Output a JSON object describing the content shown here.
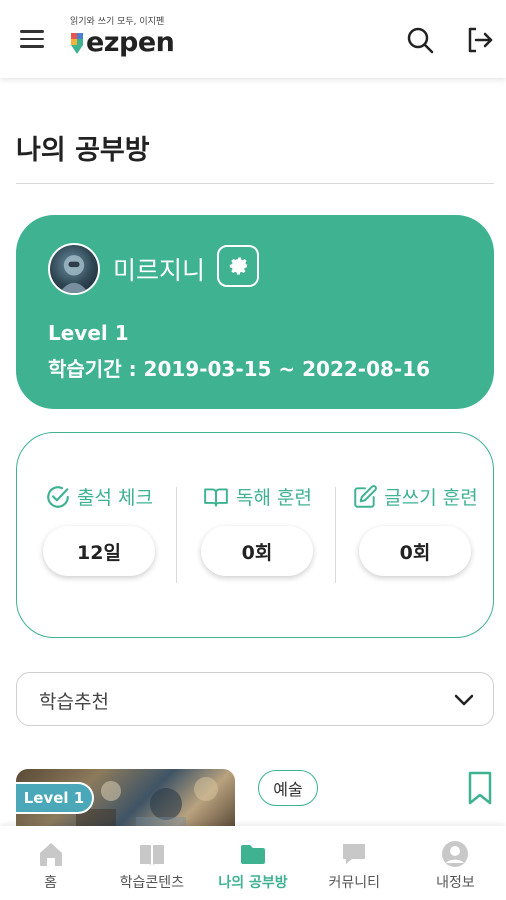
{
  "header": {
    "logo_tagline": "읽기와 쓰기 모두, 이지펜",
    "logo_text": "ezpen",
    "menu_icon": "hamburger-menu-icon",
    "search_icon": "search-icon",
    "logout_icon": "logout-icon"
  },
  "page": {
    "title": "나의 공부방"
  },
  "profile": {
    "name": "미르지니",
    "level": "Level 1",
    "period": "학습기간 : 2019-03-15 ~ 2022-08-16",
    "settings_icon": "gear-icon"
  },
  "stats": [
    {
      "label": "출석 체크",
      "value": "12일",
      "icon": "check-circle-icon"
    },
    {
      "label": "독해 훈련",
      "value": "0회",
      "icon": "open-book-icon"
    },
    {
      "label": "글쓰기 훈련",
      "value": "0회",
      "icon": "pencil-edit-icon"
    }
  ],
  "recommend_select": {
    "selected": "학습추천"
  },
  "recommendation": {
    "level_badge": "Level 1",
    "category_tag": "예술"
  },
  "bottom_nav": [
    {
      "label": "홈",
      "icon": "home-icon",
      "active": false
    },
    {
      "label": "학습콘텐츠",
      "icon": "book-icon",
      "active": false
    },
    {
      "label": "나의 공부방",
      "icon": "folder-icon",
      "active": true
    },
    {
      "label": "커뮤니티",
      "icon": "chat-bubble-icon",
      "active": false
    },
    {
      "label": "내정보",
      "icon": "user-icon",
      "active": false
    }
  ],
  "colors": {
    "accent": "#3fb292",
    "badge": "#4aa8b8",
    "nav_inactive": "#c8c8c8"
  }
}
